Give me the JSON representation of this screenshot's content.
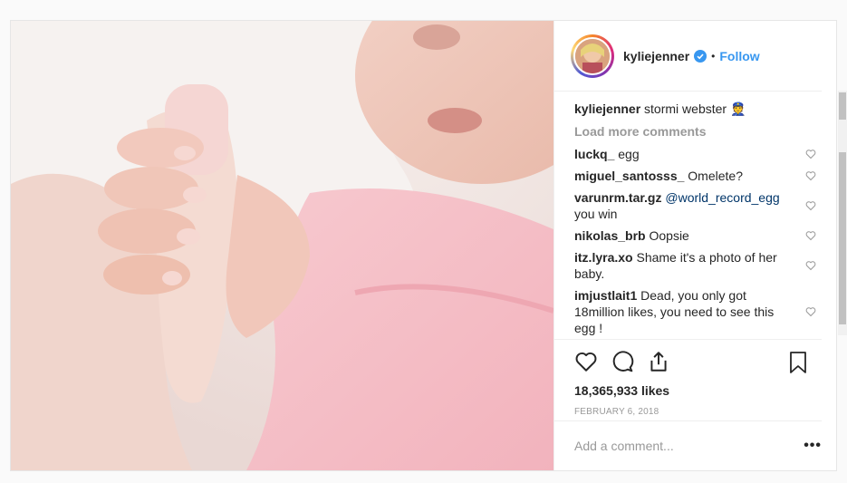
{
  "post": {
    "username": "kyliejenner",
    "follow_label": "Follow",
    "separator": "•",
    "caption_text": "stormi webster 👮",
    "load_more": "Load more comments",
    "comments": [
      {
        "user": "luckq_",
        "text": "egg"
      },
      {
        "user": "miguel_santosss_",
        "text": "Omelete?"
      },
      {
        "user": "varunrm.tar.gz",
        "mention": "@world_record_egg",
        "text": "you win"
      },
      {
        "user": "nikolas_brb",
        "text": "Oopsie"
      },
      {
        "user": "itz.lyra.xo",
        "text": "Shame it's a photo of her baby."
      },
      {
        "user": "imjustlait1",
        "text": "Dead, you only got 18million likes, you need to see this egg !"
      }
    ],
    "likes": "18,365,933 likes",
    "date": "FEBRUARY 6, 2018",
    "add_comment_placeholder": "Add a comment...",
    "more_label": "•••"
  },
  "icons": {
    "like": "heart-icon",
    "comment": "comment-bubble-icon",
    "share": "share-icon",
    "save": "bookmark-icon",
    "verified": "verified-badge-icon"
  },
  "colors": {
    "follow": "#3897f0",
    "verified": "#3897f0",
    "muted": "#999999"
  }
}
